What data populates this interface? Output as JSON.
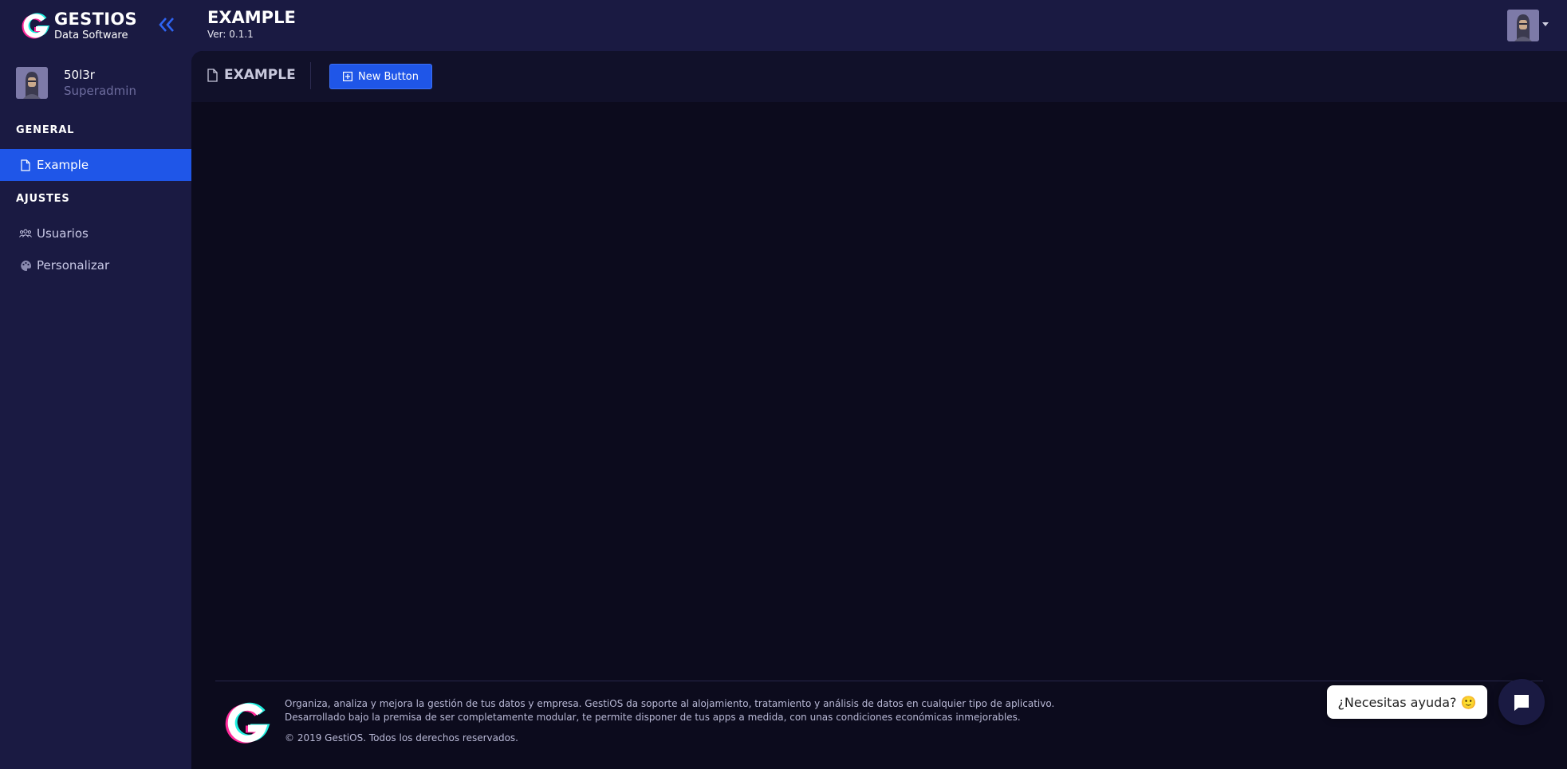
{
  "header": {
    "brand_title": "GESTIOS",
    "brand_subtitle": "Data Software",
    "page_title": "EXAMPLE",
    "version": "Ver: 0.1.1"
  },
  "sidebar": {
    "user": {
      "name": "50l3r",
      "role": "Superadmin"
    },
    "sections": [
      {
        "label": "GENERAL",
        "items": [
          {
            "label": "Example",
            "icon": "file-icon",
            "active": true
          }
        ]
      },
      {
        "label": "AJUSTES",
        "items": [
          {
            "label": "Usuarios",
            "icon": "users-icon",
            "active": false
          },
          {
            "label": "Personalizar",
            "icon": "palette-icon",
            "active": false
          }
        ]
      }
    ]
  },
  "toolbar": {
    "title": "EXAMPLE",
    "new_button_label": "New Button"
  },
  "footer": {
    "line1": "Organiza, analiza y mejora la gestión de tus datos y empresa. GestiOS da soporte al alojamiento, tratamiento y análisis de datos en cualquier tipo de aplicativo.",
    "line2": "Desarrollado bajo la premisa de ser completamente modular, te permite disponer de tus apps a medida, con unas condiciones económicas inmejorables.",
    "copyright": "© 2019 GestiOS. Todos los derechos reservados."
  },
  "help": {
    "bubble_text": "¿Necesitas ayuda? 🙂"
  },
  "colors": {
    "accent": "#1f56e8",
    "sidebar_bg": "#1a1a42",
    "main_bg": "#0c0b1d"
  }
}
